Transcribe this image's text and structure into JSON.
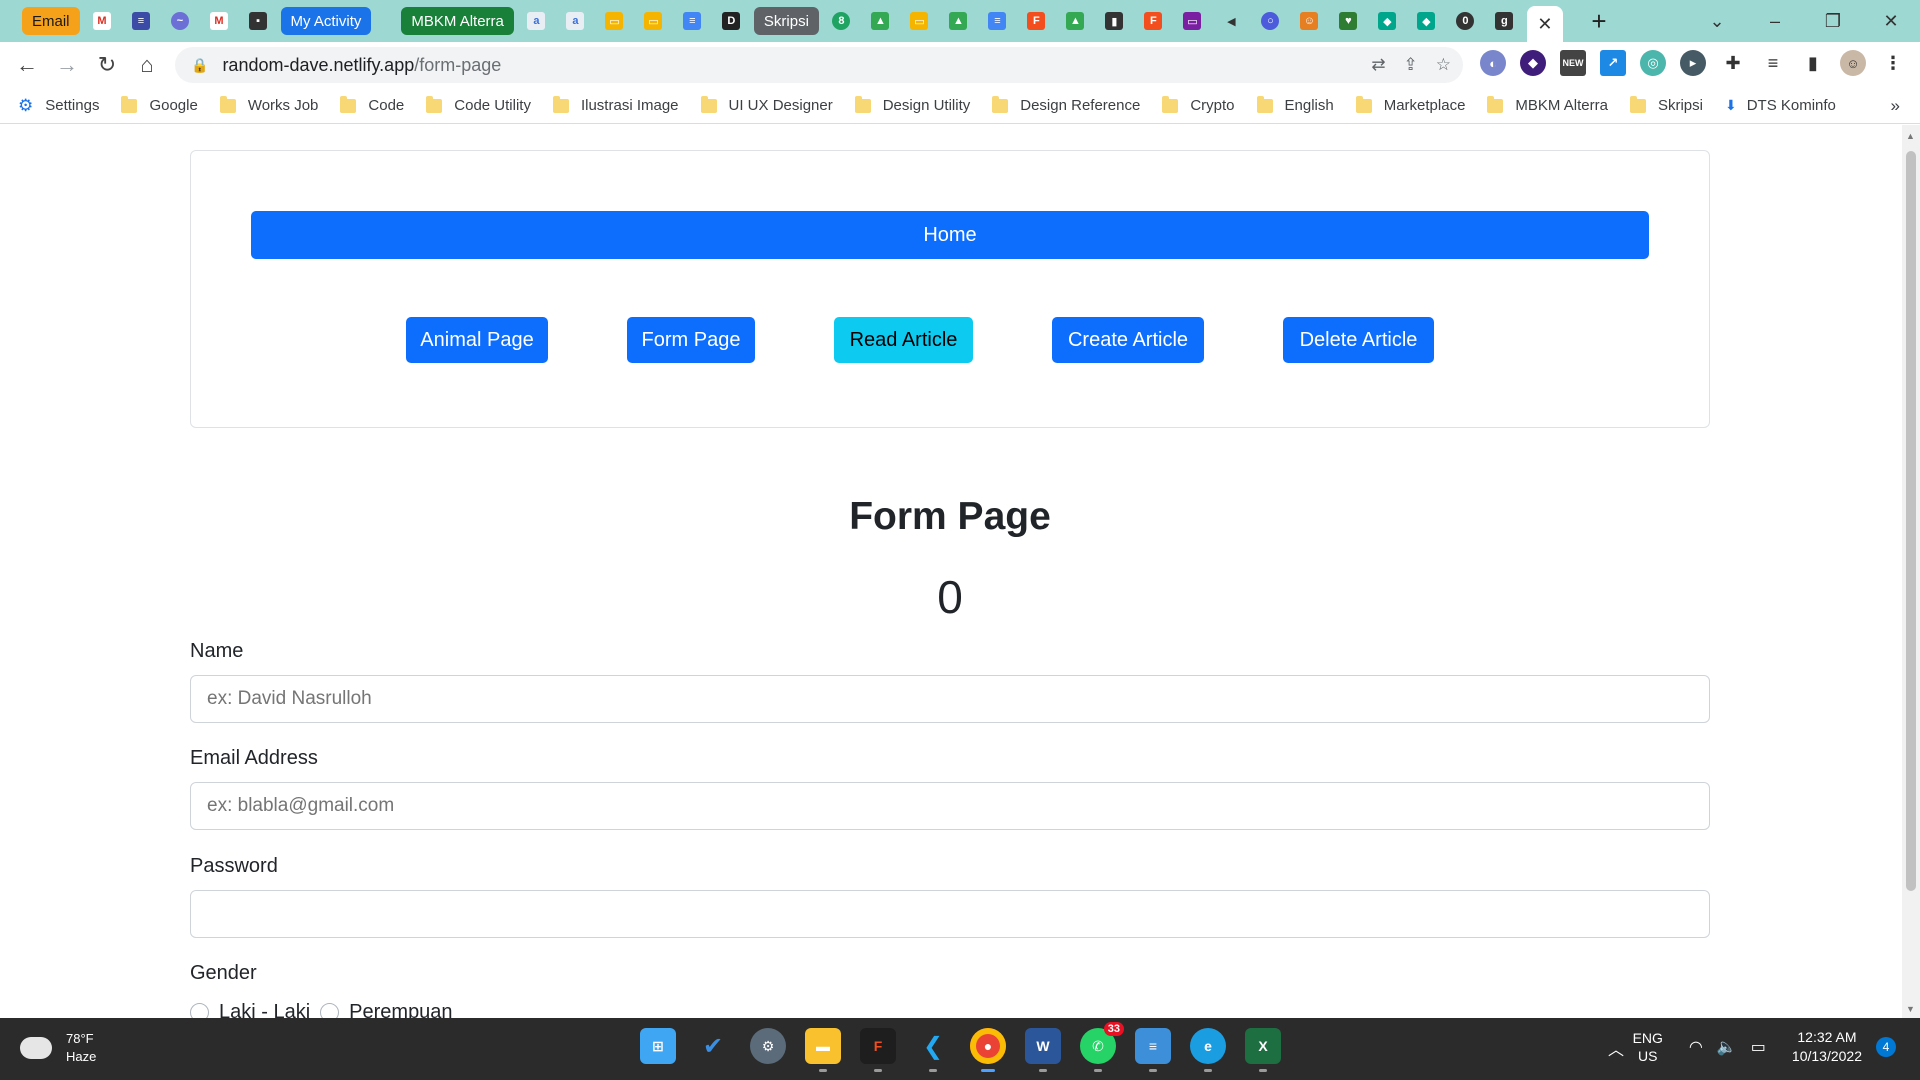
{
  "browser": {
    "tab_groups": [
      {
        "label": "Email",
        "color": "#f6a11a",
        "text_color": "#1a1a1a"
      },
      {
        "label": "My Activity",
        "color": "#1a73e8",
        "text_color": "#ffffff"
      },
      {
        "label": "MBKM Alterra",
        "color": "#188038",
        "text_color": "#ffffff"
      },
      {
        "label": "Skripsi",
        "color": "#5f6368",
        "text_color": "#ffffff"
      }
    ],
    "active_tab_close": "✕",
    "new_tab": "+",
    "url_host": "random-dave.netlify.app",
    "url_path": "/form-page"
  },
  "bookmarks": [
    {
      "label": "Settings",
      "icon": "gear-icon"
    },
    {
      "label": "Google",
      "icon": "folder-icon"
    },
    {
      "label": "Works Job",
      "icon": "folder-icon"
    },
    {
      "label": "Code",
      "icon": "folder-icon"
    },
    {
      "label": "Code Utility",
      "icon": "folder-icon"
    },
    {
      "label": "Ilustrasi Image",
      "icon": "folder-icon"
    },
    {
      "label": "UI UX Designer",
      "icon": "folder-icon"
    },
    {
      "label": "Design Utility",
      "icon": "folder-icon"
    },
    {
      "label": "Design Reference",
      "icon": "folder-icon"
    },
    {
      "label": "Crypto",
      "icon": "folder-icon"
    },
    {
      "label": "English",
      "icon": "folder-icon"
    },
    {
      "label": "Marketplace",
      "icon": "folder-icon"
    },
    {
      "label": "MBKM Alterra",
      "icon": "folder-icon"
    },
    {
      "label": "Skripsi",
      "icon": "folder-icon"
    },
    {
      "label": "DTS Kominfo",
      "icon": "dts-icon"
    }
  ],
  "nav": {
    "home": "Home",
    "buttons": [
      {
        "label": "Animal Page",
        "variant": "primary"
      },
      {
        "label": "Form Page",
        "variant": "primary"
      },
      {
        "label": "Read Article",
        "variant": "info"
      },
      {
        "label": "Create Article",
        "variant": "primary"
      },
      {
        "label": "Delete Article",
        "variant": "primary"
      }
    ]
  },
  "page": {
    "title": "Form Page",
    "counter": "0"
  },
  "form": {
    "name_label": "Name",
    "name_placeholder": "ex: David Nasrulloh",
    "email_label": "Email Address",
    "email_placeholder": "ex: blabla@gmail.com",
    "password_label": "Password",
    "password_value": "",
    "gender_label": "Gender",
    "gender_options": [
      "Laki - Laki",
      "Perempuan"
    ]
  },
  "taskbar": {
    "weather_temp": "78°F",
    "weather_desc": "Haze",
    "whatsapp_badge": "33",
    "lang_top": "ENG",
    "lang_bottom": "US",
    "time": "12:32 AM",
    "date": "10/13/2022",
    "notification_count": "4"
  },
  "colors": {
    "primary": "#0d6efd",
    "info": "#0dcaf0",
    "tabstrip": "#9ed8d3"
  }
}
